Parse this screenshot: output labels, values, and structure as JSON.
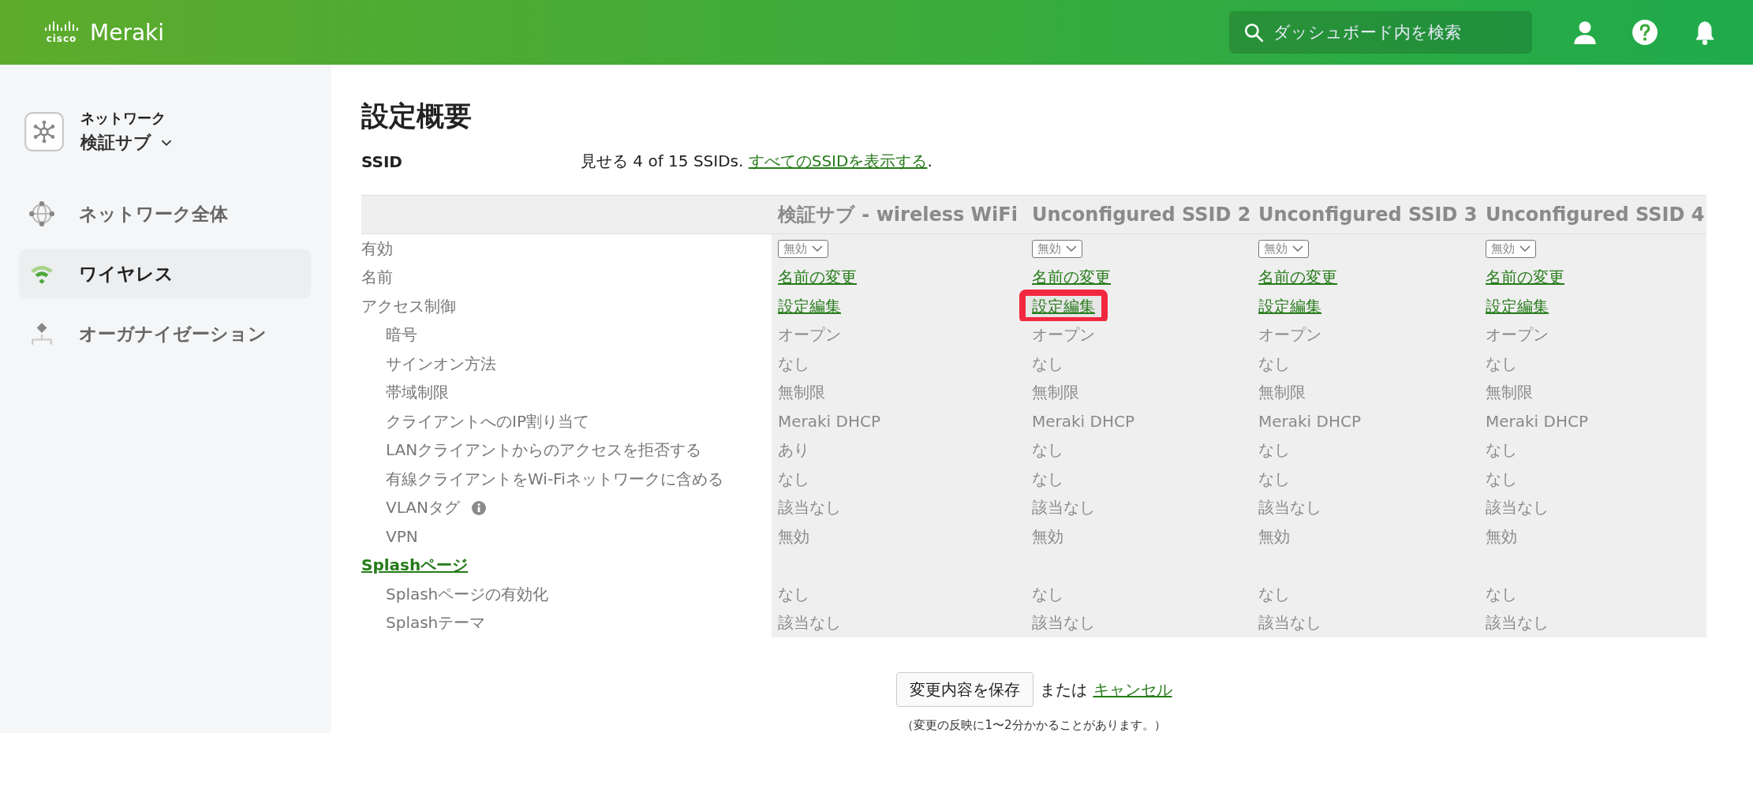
{
  "header": {
    "logo_mark": "cisco",
    "brand": "Meraki",
    "search": {
      "placeholder": "ダッシュボード内を検索"
    }
  },
  "sidebar": {
    "network": {
      "caption": "ネットワーク",
      "name": "検証サブ"
    },
    "items": [
      {
        "label": "ネットワーク全体",
        "selected": false
      },
      {
        "label": "ワイヤレス",
        "selected": true
      },
      {
        "label": "オーガナイゼーション",
        "selected": false
      }
    ]
  },
  "page": {
    "title": "設定概要",
    "ssid_label": "SSID",
    "ssid_summary": "見せる 4 of 15 SSIDs. ",
    "ssid_link": "すべてのSSIDを表示する",
    "ssid_end": "."
  },
  "table": {
    "columns": [
      "検証サブ - wireless WiFi",
      "Unconfigured SSID 2",
      "Unconfigured SSID 3",
      "Unconfigured SSID 4"
    ],
    "rows": [
      {
        "label": "有効",
        "kind": "select",
        "values": [
          "無効",
          "無効",
          "無効",
          "無効"
        ]
      },
      {
        "label": "名前",
        "kind": "link",
        "values": [
          "名前の変更",
          "名前の変更",
          "名前の変更",
          "名前の変更"
        ]
      },
      {
        "label": "アクセス制御",
        "kind": "link",
        "cells": [
          {
            "text": "設定編集",
            "highlighted": false
          },
          {
            "text": "設定編集",
            "highlighted": true
          },
          {
            "text": "設定編集",
            "highlighted": false
          },
          {
            "text": "設定編集",
            "highlighted": false
          }
        ],
        "children": [
          {
            "label": "暗号",
            "kind": "text",
            "values": [
              "オープン",
              "オープン",
              "オープン",
              "オープン"
            ]
          },
          {
            "label": "サインオン方法",
            "kind": "text",
            "values": [
              "なし",
              "なし",
              "なし",
              "なし"
            ]
          },
          {
            "label": "帯域制限",
            "kind": "text",
            "values": [
              "無制限",
              "無制限",
              "無制限",
              "無制限"
            ]
          },
          {
            "label": "クライアントへのIP割り当て",
            "kind": "text",
            "values": [
              "Meraki DHCP",
              "Meraki DHCP",
              "Meraki DHCP",
              "Meraki DHCP"
            ]
          },
          {
            "label": "LANクライアントからのアクセスを拒否する",
            "kind": "text",
            "values": [
              "あり",
              "なし",
              "なし",
              "なし"
            ]
          },
          {
            "label": "有線クライアントをWi-Fiネットワークに含める",
            "kind": "text",
            "values": [
              "なし",
              "なし",
              "なし",
              "なし"
            ]
          },
          {
            "label": "VLANタグ",
            "kind": "text",
            "info": true,
            "values": [
              "該当なし",
              "該当なし",
              "該当なし",
              "該当なし"
            ]
          },
          {
            "label": "VPN",
            "kind": "text",
            "values": [
              "無効",
              "無効",
              "無効",
              "無効"
            ]
          }
        ]
      },
      {
        "label": "Splashページ",
        "kind": "section_link",
        "children": [
          {
            "label": "Splashページの有効化",
            "kind": "text",
            "values": [
              "なし",
              "なし",
              "なし",
              "なし"
            ]
          },
          {
            "label": "Splashテーマ",
            "kind": "text",
            "values": [
              "該当なし",
              "該当なし",
              "該当なし",
              "該当なし"
            ]
          }
        ]
      }
    ]
  },
  "footer": {
    "save_button": "変更内容を保存",
    "or_text": "または",
    "cancel_link": "キャンセル",
    "note": "（変更の反映に1〜2分かかることがあります。）"
  }
}
